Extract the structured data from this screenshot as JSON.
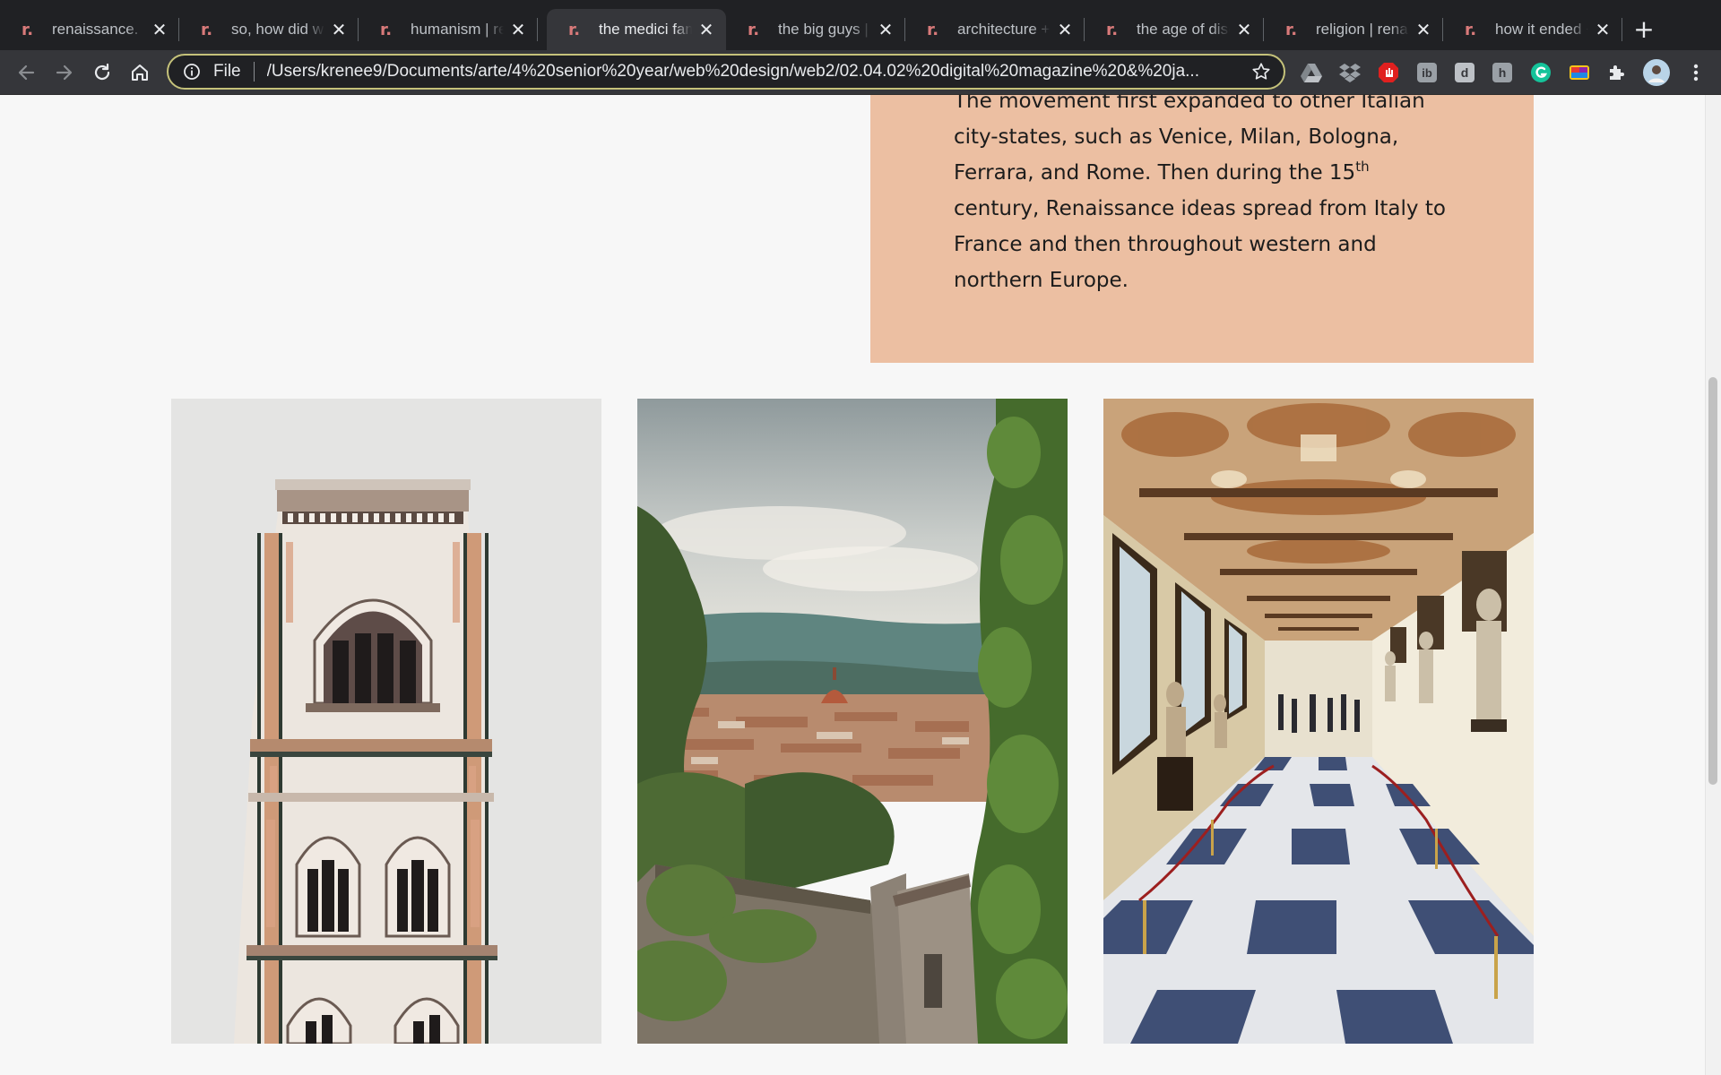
{
  "browser": {
    "tabs": [
      {
        "title": "renaissance.",
        "active": false
      },
      {
        "title": "so, how did we",
        "active": false
      },
      {
        "title": "humanism | ren",
        "active": false
      },
      {
        "title": "the medici fami",
        "active": true
      },
      {
        "title": "the big guys | r",
        "active": false
      },
      {
        "title": "architecture + a",
        "active": false
      },
      {
        "title": "the age of disc",
        "active": false
      },
      {
        "title": "religion | renais",
        "active": false
      },
      {
        "title": "how it ended +",
        "active": false
      }
    ],
    "tab_favicon": "r.",
    "tab_close_glyph": "✕",
    "new_tab_glyph": "+",
    "address": {
      "scheme_label": "File",
      "url": "/Users/krenee9/Documents/arte/4%20senior%20year/web%20design/web2/02.04.02%20digital%20magazine%20&%20ja..."
    },
    "extensions": [
      "google-drive-icon",
      "dropbox-icon",
      "adblock-icon",
      "ib-extension",
      "d-extension",
      "h-extension",
      "grammarly-icon",
      "color-picker-icon",
      "puzzle-extensions-icon",
      "profile-avatar"
    ]
  },
  "article": {
    "paragraph_lead": "The movement first expanded to other Italian city-states, such as Venice, Milan, Bologna, Ferrara, and Rome. Then during the 15",
    "paragraph_sup": "th",
    "paragraph_tail": " century, Renaissance ideas spread from Italy to France and then throughout western and northern Europe.",
    "box_color": "#ecbfa2"
  },
  "gallery": [
    {
      "subject": "bell-tower-photo"
    },
    {
      "subject": "florence-view-photo"
    },
    {
      "subject": "gallery-corridor-photo"
    }
  ],
  "colors": {
    "tab_bg": "#202124",
    "toolbar_bg": "#35363a",
    "page_bg": "#f7f7f7",
    "favicon": "#d97a7a",
    "omnibox_outline": "#c5c27a"
  }
}
